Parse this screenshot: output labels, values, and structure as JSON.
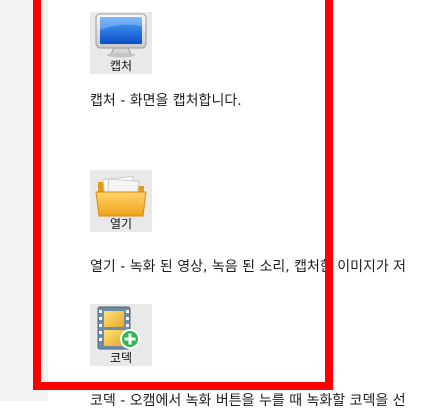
{
  "items": [
    {
      "icon_name": "monitor-icon",
      "label": "캡처",
      "description": "캡처 - 화면을 캡처합니다."
    },
    {
      "icon_name": "folder-icon",
      "label": "열기",
      "description": "열기 - 녹화 된 영상, 녹음 된 소리, 캡처한 이미지가 저"
    },
    {
      "icon_name": "film-add-icon",
      "label": "코덱",
      "description": "코덱 - 오캠에서 녹화 버튼을 누를 때 녹화할 코덱을 선"
    }
  ],
  "colors": {
    "highlight_frame": "#ff0000",
    "gutter": "#f3f3f3"
  }
}
